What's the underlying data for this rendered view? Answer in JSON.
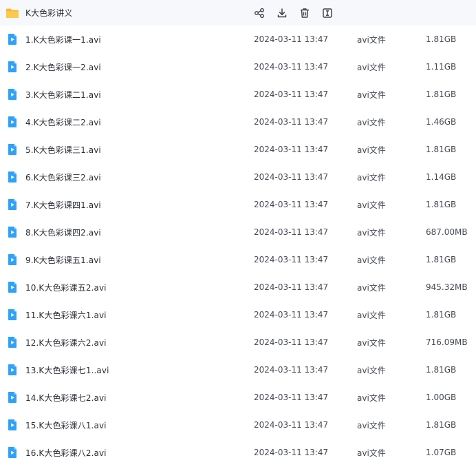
{
  "folder": {
    "name": "K大色彩讲义",
    "icon": "folder-icon",
    "color": "#f6b93b",
    "actions": [
      "share-icon",
      "download-icon",
      "trash-icon",
      "rename-icon"
    ]
  },
  "file_icon": {
    "name": "video-file-icon",
    "color": "#2ea2f8"
  },
  "files": [
    {
      "name": "1.K大色彩课一1.avi",
      "date": "2024-03-11 13:47",
      "type": "avi文件",
      "size": "1.81GB"
    },
    {
      "name": "2.K大色彩课一2.avi",
      "date": "2024-03-11 13:47",
      "type": "avi文件",
      "size": "1.11GB"
    },
    {
      "name": "3.K大色彩课二1.avi",
      "date": "2024-03-11 13:47",
      "type": "avi文件",
      "size": "1.81GB"
    },
    {
      "name": "4.K大色彩课二2.avi",
      "date": "2024-03-11 13:47",
      "type": "avi文件",
      "size": "1.46GB"
    },
    {
      "name": "5.K大色彩课三1.avi",
      "date": "2024-03-11 13:47",
      "type": "avi文件",
      "size": "1.81GB"
    },
    {
      "name": "6.K大色彩课三2.avi",
      "date": "2024-03-11 13:47",
      "type": "avi文件",
      "size": "1.14GB"
    },
    {
      "name": "7.K大色彩课四1.avi",
      "date": "2024-03-11 13:47",
      "type": "avi文件",
      "size": "1.81GB"
    },
    {
      "name": "8.K大色彩课四2.avi",
      "date": "2024-03-11 13:47",
      "type": "avi文件",
      "size": "687.00MB"
    },
    {
      "name": "9.K大色彩课五1.avi",
      "date": "2024-03-11 13:47",
      "type": "avi文件",
      "size": "1.81GB"
    },
    {
      "name": "10.K大色彩课五2.avi",
      "date": "2024-03-11 13:47",
      "type": "avi文件",
      "size": "945.32MB"
    },
    {
      "name": "11.K大色彩课六1.avi",
      "date": "2024-03-11 13:47",
      "type": "avi文件",
      "size": "1.81GB"
    },
    {
      "name": "12.K大色彩课六2.avi",
      "date": "2024-03-11 13:47",
      "type": "avi文件",
      "size": "716.09MB"
    },
    {
      "name": "13.K大色彩课七1..avi",
      "date": "2024-03-11 13:47",
      "type": "avi文件",
      "size": "1.81GB"
    },
    {
      "name": "14.K大色彩课七2.avi",
      "date": "2024-03-11 13:47",
      "type": "avi文件",
      "size": "1.00GB"
    },
    {
      "name": "15.K大色彩课八1.avi",
      "date": "2024-03-11 13:47",
      "type": "avi文件",
      "size": "1.81GB"
    },
    {
      "name": "16.K大色彩课八2.avi",
      "date": "2024-03-11 13:47",
      "type": "avi文件",
      "size": "1.07GB"
    }
  ]
}
